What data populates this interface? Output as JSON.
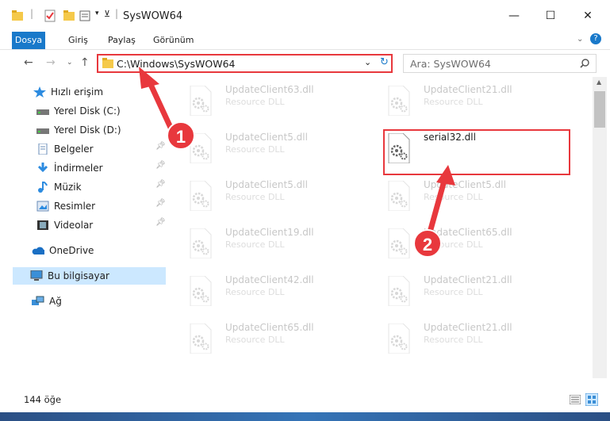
{
  "window": {
    "title": "SysWOW64",
    "controls": {
      "minimize": "—",
      "maximize": "☐",
      "close": "✕"
    }
  },
  "ribbon": {
    "tabs": [
      "Dosya",
      "Giriş",
      "Paylaş",
      "Görünüm"
    ],
    "help": "?"
  },
  "nav": {
    "address": "C:\\Windows\\SysWOW64",
    "search_placeholder": "Ara: SysWOW64"
  },
  "sidebar": {
    "items": [
      {
        "label": "Hızlı erişim",
        "icon": "star-icon"
      },
      {
        "label": "Yerel Disk (C:)",
        "icon": "drive-icon"
      },
      {
        "label": "Yerel Disk (D:)",
        "icon": "drive-icon"
      },
      {
        "label": "Belgeler",
        "icon": "documents-icon"
      },
      {
        "label": "İndirmeler",
        "icon": "download-icon"
      },
      {
        "label": "Müzik",
        "icon": "music-icon"
      },
      {
        "label": "Resimler",
        "icon": "pictures-icon"
      },
      {
        "label": "Videolar",
        "icon": "video-icon"
      },
      {
        "label": "OneDrive",
        "icon": "cloud-icon"
      },
      {
        "label": "Bu bilgisayar",
        "icon": "computer-icon"
      },
      {
        "label": "Ağ",
        "icon": "network-icon"
      }
    ]
  },
  "files": {
    "left": [
      {
        "name": "UpdateClient63.dll",
        "type": "Resource DLL"
      },
      {
        "name": "UpdateClient5.dll",
        "type": "Resource DLL"
      },
      {
        "name": "UpdateClient5.dll",
        "type": "Resource DLL"
      },
      {
        "name": "UpdateClient19.dll",
        "type": "Resource DLL"
      },
      {
        "name": "UpdateClient42.dll",
        "type": "Resource DLL"
      },
      {
        "name": "UpdateClient65.dll",
        "type": "Resource DLL"
      }
    ],
    "right": [
      {
        "name": "UpdateClient21.dll",
        "type": "Resource DLL"
      },
      {
        "name": "serial32.dll",
        "type": ""
      },
      {
        "name": "UpdateClient5.dll",
        "type": "Resource DLL"
      },
      {
        "name": "UpdateClient65.dll",
        "type": "Resource DLL"
      },
      {
        "name": "UpdateClient21.dll",
        "type": "Resource DLL"
      },
      {
        "name": "UpdateClient21.dll",
        "type": "Resource DLL"
      }
    ]
  },
  "status": {
    "count": "144 öğe"
  },
  "annotations": {
    "step1": "1",
    "step2": "2",
    "color": "#e8383d"
  }
}
